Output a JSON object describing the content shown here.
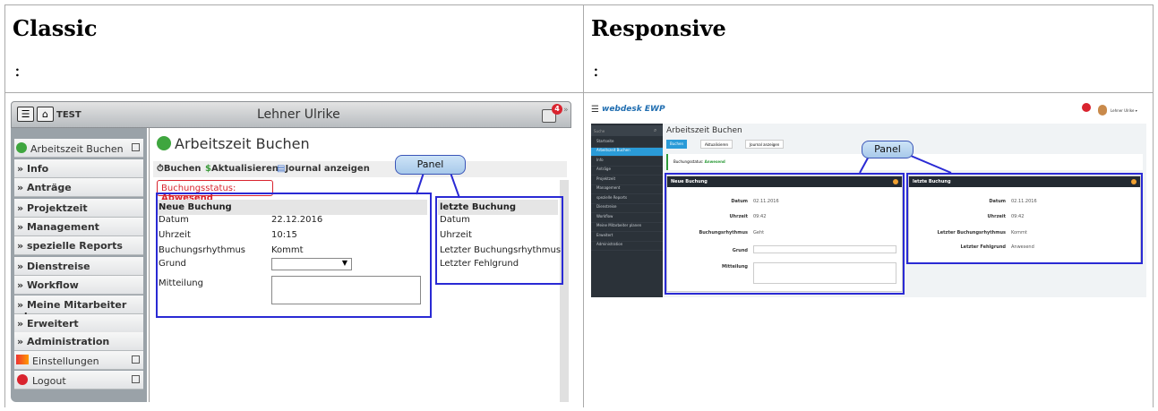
{
  "headers": {
    "classic": "Classic",
    "responsive": "Responsive",
    "colon": ":"
  },
  "classic": {
    "top_bar": {
      "app": "TEST",
      "user": "Lehner Ulrike",
      "badge": "4"
    },
    "sidebar": [
      {
        "label": "Arbeitszeit Buchen",
        "kind": "green"
      },
      {
        "label": "Info",
        "kind": "chevron"
      },
      {
        "label": "Anträge",
        "kind": "chevron"
      },
      {
        "label": "Projektzeit",
        "kind": "chevron"
      },
      {
        "label": "Management",
        "kind": "chevron"
      },
      {
        "label": "spezielle Reports",
        "kind": "chevron"
      },
      {
        "label": "Dienstreise",
        "kind": "chevron"
      },
      {
        "label": "Workflow",
        "kind": "chevron"
      },
      {
        "label": "Meine Mitarbeiter planen",
        "kind": "chevron"
      },
      {
        "label": "Erweitert",
        "kind": "chevron"
      },
      {
        "label": "Administration",
        "kind": "chevron"
      },
      {
        "label": "Einstellungen",
        "kind": "settings"
      },
      {
        "label": "Logout",
        "kind": "logout"
      }
    ],
    "page_title": "Arbeitszeit Buchen",
    "toolbar": {
      "buchen": "Buchen",
      "aktualisieren": "Aktualisieren",
      "journal": "Journal anzeigen"
    },
    "status_prefix": "Buchungsstatus:",
    "status_value": "Abwesend",
    "neue_buchung": {
      "title": "Neue Buchung",
      "datum_label": "Datum",
      "datum_value": "22.12.2016",
      "uhrzeit_label": "Uhrzeit",
      "uhrzeit_value": "10:15",
      "rhythmus_label": "Buchungsrhythmus",
      "rhythmus_value": "Kommt",
      "grund_label": "Grund",
      "mitteilung_label": "Mitteilung"
    },
    "letzte_buchung": {
      "title": "letzte Buchung",
      "rows": [
        "Datum",
        "Uhrzeit",
        "Letzter Buchungsrhythmus",
        "Letzter Fehlgrund"
      ]
    },
    "callout": "Panel"
  },
  "responsive": {
    "brand": "webdesk EWP",
    "user": "Lehner Ulrike ▾",
    "search_placeholder": "Suche",
    "sidebar": [
      "Startseite",
      "Arbeitszeit Buchen",
      "Info",
      "Anträge",
      "Projektzeit",
      "Management",
      "spezielle Reports",
      "Dienstreise",
      "Workflow",
      "Meine Mitarbeiter planen",
      "Erweitert",
      "Administration"
    ],
    "page_title": "Arbeitszeit Buchen",
    "buttons": {
      "buchen": "Buchen",
      "aktualisieren": "Aktualisieren",
      "journal": "Journal anzeigen"
    },
    "status_prefix": "Buchungsstatus:",
    "status_value": "Anwesend",
    "neue_buchung": {
      "title": "Neue Buchung",
      "datum_label": "Datum",
      "datum_value": "02.11.2016",
      "uhrzeit_label": "Uhrzeit",
      "uhrzeit_value": "09:42",
      "rhythmus_label": "Buchungsrhythmus",
      "rhythmus_value": "Geht",
      "grund_label": "Grund",
      "mitteilung_label": "Mitteilung"
    },
    "letzte_buchung": {
      "title": "letzte Buchung",
      "datum_label": "Datum",
      "datum_value": "02.11.2016",
      "uhrzeit_label": "Uhrzeit",
      "uhrzeit_value": "09:42",
      "rhythmus_label": "Letzter Buchungsrhythmus",
      "rhythmus_value": "Kommt",
      "fehlgrund_label": "Letzter Fehlgrund",
      "fehlgrund_value": "Anwesend"
    },
    "callout": "Panel"
  },
  "colors": {
    "accent_blue": "#2a2ad4",
    "status_red": "#d9232e",
    "status_green": "#2e9b3a",
    "resp_button": "#2a9bd8"
  }
}
